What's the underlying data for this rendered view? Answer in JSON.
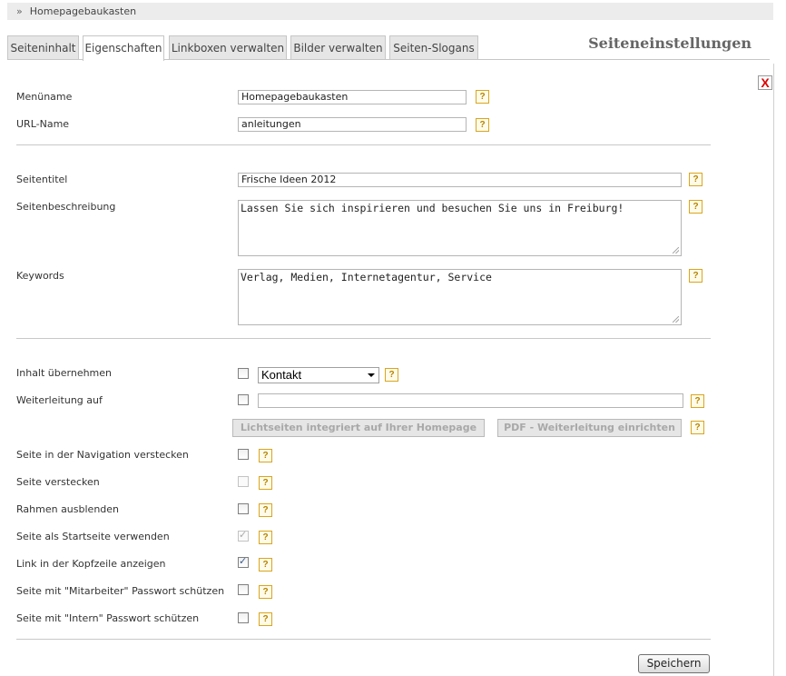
{
  "breadcrumb": {
    "separator": "»",
    "item": "Homepagebaukasten"
  },
  "tabs": [
    {
      "label": "Seiteninhalt"
    },
    {
      "label": "Eigenschaften"
    },
    {
      "label": "Linkboxen verwalten"
    },
    {
      "label": "Bilder verwalten"
    },
    {
      "label": "Seiten-Slogans"
    }
  ],
  "page_title": "Seiteneinstellungen",
  "close_label": "X",
  "help_label": "?",
  "fields": {
    "menuname": {
      "label": "Menüname",
      "value": "Homepagebaukasten"
    },
    "urlname": {
      "label": "URL-Name",
      "value": "anleitungen"
    },
    "seitentitel": {
      "label": "Seitentitel",
      "value": "Frische Ideen 2012"
    },
    "seitenbeschreibung": {
      "label": "Seitenbeschreibung",
      "value": "Lassen Sie sich inspirieren und besuchen Sie uns in Freiburg!"
    },
    "keywords": {
      "label": "Keywords",
      "value": "Verlag, Medien, Internetagentur, Service"
    },
    "inhalt": {
      "label": "Inhalt übernehmen",
      "selected": "Kontakt"
    },
    "weiterleitung": {
      "label": "Weiterleitung auf",
      "value": ""
    }
  },
  "buttons": {
    "lichtseiten": "Lichtseiten integriert auf Ihrer Homepage",
    "pdf": "PDF - Weiterleitung einrichten",
    "save": "Speichern"
  },
  "options": [
    {
      "label": "Seite in der Navigation verstecken",
      "checked": false,
      "disabled": false
    },
    {
      "label": "Seite verstecken",
      "checked": false,
      "disabled": true
    },
    {
      "label": "Rahmen ausblenden",
      "checked": false,
      "disabled": false
    },
    {
      "label": "Seite als Startseite verwenden",
      "checked": true,
      "disabled": true
    },
    {
      "label": "Link in der Kopfzeile anzeigen",
      "checked": true,
      "disabled": false
    },
    {
      "label": "Seite mit \"Mitarbeiter\" Passwort schützen",
      "checked": false,
      "disabled": false
    },
    {
      "label": "Seite mit \"Intern\" Passwort schützen",
      "checked": false,
      "disabled": false
    }
  ]
}
